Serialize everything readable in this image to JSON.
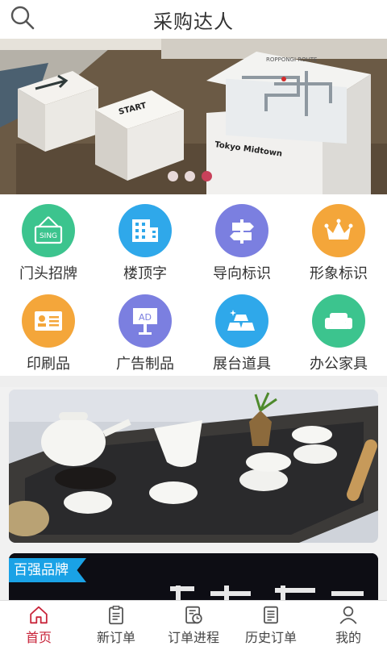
{
  "header": {
    "title": "采购达人",
    "search_icon": "search-icon"
  },
  "banner": {
    "slides": 3,
    "active_slide": 3,
    "scene_texts": [
      "START",
      "Tokyo Midtown",
      "ROPPONGI ROUTE"
    ]
  },
  "categories": [
    {
      "label": "门头招牌",
      "icon": "signboard-icon",
      "color": "#3cc48e",
      "badge": "SING"
    },
    {
      "label": "楼顶字",
      "icon": "building-icon",
      "color": "#2fa8ea"
    },
    {
      "label": "导向标识",
      "icon": "signpost-icon",
      "color": "#7b7fe0"
    },
    {
      "label": "形象标识",
      "icon": "crown-icon",
      "color": "#f4a63a"
    },
    {
      "label": "印刷品",
      "icon": "card-icon",
      "color": "#f4a63a"
    },
    {
      "label": "广告制品",
      "icon": "ad-board-icon",
      "color": "#7b7fe0",
      "badge": "AD"
    },
    {
      "label": "展台道具",
      "icon": "gold-bars-icon",
      "color": "#2fa8ea"
    },
    {
      "label": "办公家具",
      "icon": "sofa-icon",
      "color": "#3cc48e"
    }
  ],
  "promo": {
    "brand_tag": "百强品牌"
  },
  "tabs": [
    {
      "label": "首页",
      "icon": "home-icon",
      "active": true
    },
    {
      "label": "新订单",
      "icon": "clipboard-icon",
      "active": false
    },
    {
      "label": "订单进程",
      "icon": "clock-document-icon",
      "active": false
    },
    {
      "label": "历史订单",
      "icon": "list-document-icon",
      "active": false
    },
    {
      "label": "我的",
      "icon": "user-icon",
      "active": false
    }
  ],
  "colors": {
    "accent": "#c8243a",
    "tag_blue": "#1aa2e6"
  }
}
